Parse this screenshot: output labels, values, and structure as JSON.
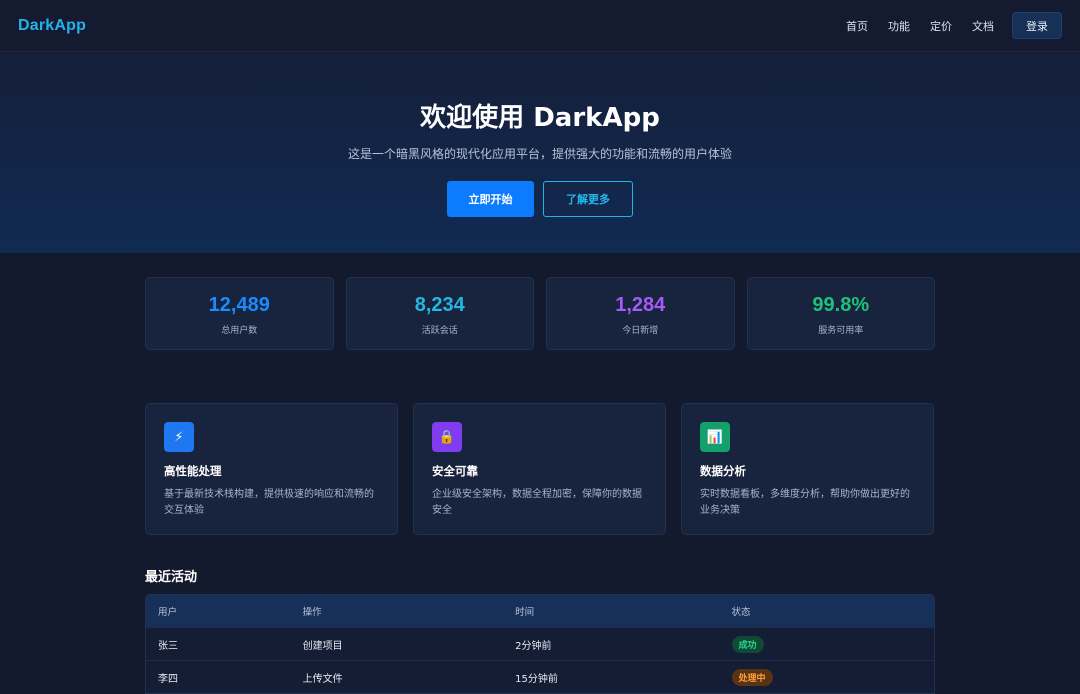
{
  "nav": {
    "brand": "DarkApp",
    "links": [
      "首页",
      "功能",
      "定价",
      "文档"
    ],
    "login": "登录"
  },
  "hero": {
    "title": "欢迎使用 DarkApp",
    "subtitle": "这是一个暗黑风格的现代化应用平台，提供强大的功能和流畅的用户体验",
    "primary_button": "立即开始",
    "secondary_button": "了解更多"
  },
  "stats": [
    {
      "value": "12,489",
      "label": "总用户数",
      "color": "#1a8cff"
    },
    {
      "value": "8,234",
      "label": "活跃会话",
      "color": "#22b8e3"
    },
    {
      "value": "1,284",
      "label": "今日新增",
      "color": "#a35cf5"
    },
    {
      "value": "99.8%",
      "label": "服务可用率",
      "color": "#20c07a"
    }
  ],
  "features": [
    {
      "icon": "lightning-icon",
      "glyph": "⚡",
      "icon_bg": "#1f78f2",
      "title": "高性能处理",
      "desc": "基于最新技术栈构建，提供极速的响应和流畅的交互体验"
    },
    {
      "icon": "lock-icon",
      "glyph": "🔒",
      "icon_bg": "#7f3cf0",
      "title": "安全可靠",
      "desc": "企业级安全架构，数据全程加密，保障你的数据安全"
    },
    {
      "icon": "chart-icon",
      "glyph": "📊",
      "icon_bg": "#14a06a",
      "title": "数据分析",
      "desc": "实时数据看板，多维度分析，帮助你做出更好的业务决策"
    }
  ],
  "activity": {
    "title": "最近活动",
    "headers": [
      "用户",
      "操作",
      "时间",
      "状态"
    ],
    "rows": [
      {
        "user": "张三",
        "action": "创建项目",
        "time": "2分钟前",
        "status": "成功",
        "status_type": "success"
      },
      {
        "user": "李四",
        "action": "上传文件",
        "time": "15分钟前",
        "status": "处理中",
        "status_type": "pending"
      }
    ]
  }
}
